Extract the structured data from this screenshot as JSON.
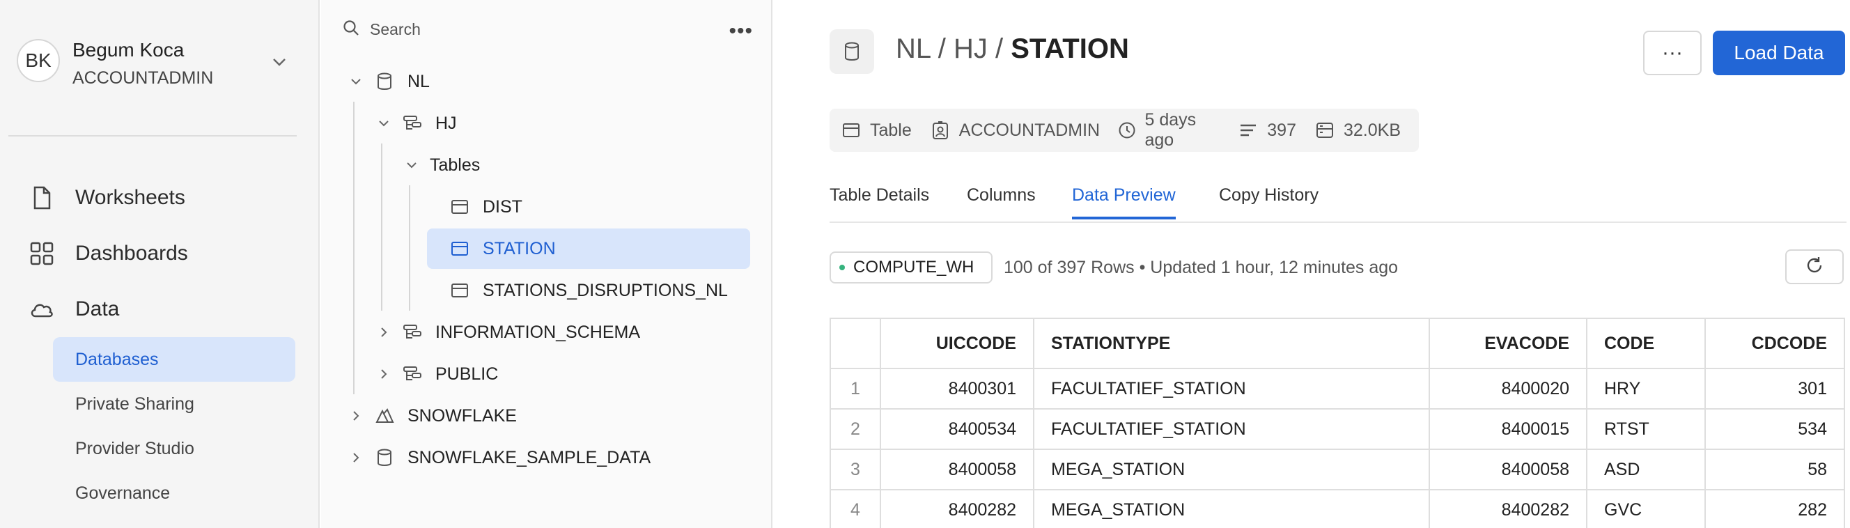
{
  "user": {
    "initials": "BK",
    "name": "Begum Koca",
    "role": "ACCOUNTADMIN"
  },
  "nav": {
    "items": [
      {
        "label": "Worksheets",
        "icon": "file-icon"
      },
      {
        "label": "Dashboards",
        "icon": "grid-icon"
      },
      {
        "label": "Data",
        "icon": "cloud-icon"
      }
    ],
    "sub_items": [
      {
        "label": "Databases",
        "active": true
      },
      {
        "label": "Private Sharing"
      },
      {
        "label": "Provider Studio"
      },
      {
        "label": "Governance"
      }
    ]
  },
  "tree": {
    "search_placeholder": "Search",
    "nodes": [
      {
        "label": "NL"
      },
      {
        "label": "HJ"
      },
      {
        "label": "Tables"
      },
      {
        "label": "DIST"
      },
      {
        "label": "STATION",
        "selected": true
      },
      {
        "label": "STATIONS_DISRUPTIONS_NL"
      },
      {
        "label": "INFORMATION_SCHEMA"
      },
      {
        "label": "PUBLIC"
      },
      {
        "label": "SNOWFLAKE"
      },
      {
        "label": "SNOWFLAKE_SAMPLE_DATA"
      }
    ]
  },
  "header": {
    "path_prefix": "NL / HJ / ",
    "path_last": "STATION",
    "load_button": "Load Data",
    "more_button": "···"
  },
  "meta": {
    "type": "Table",
    "owner": "ACCOUNTADMIN",
    "modified": "5 days ago",
    "rows": "397",
    "size": "32.0KB"
  },
  "tabs": [
    "Table Details",
    "Columns",
    "Data Preview",
    "Copy History"
  ],
  "active_tab": "Data Preview",
  "preview": {
    "warehouse": "COMPUTE_WH",
    "row_info": "100 of 397 Rows • Updated 1 hour, 12 minutes ago",
    "columns": [
      "UICCODE",
      "STATIONTYPE",
      "EVACODE",
      "CODE",
      "CDCODE"
    ],
    "rows": [
      [
        "1",
        "8400301",
        "FACULTATIEF_STATION",
        "8400020",
        "HRY",
        "301"
      ],
      [
        "2",
        "8400534",
        "FACULTATIEF_STATION",
        "8400015",
        "RTST",
        "534"
      ],
      [
        "3",
        "8400058",
        "MEGA_STATION",
        "8400058",
        "ASD",
        "58"
      ],
      [
        "4",
        "8400282",
        "MEGA_STATION",
        "8400282",
        "GVC",
        "282"
      ]
    ]
  },
  "colors": {
    "accent": "#2266d6",
    "selected_bg": "#d8e5fb",
    "status_green": "#36b37e"
  }
}
